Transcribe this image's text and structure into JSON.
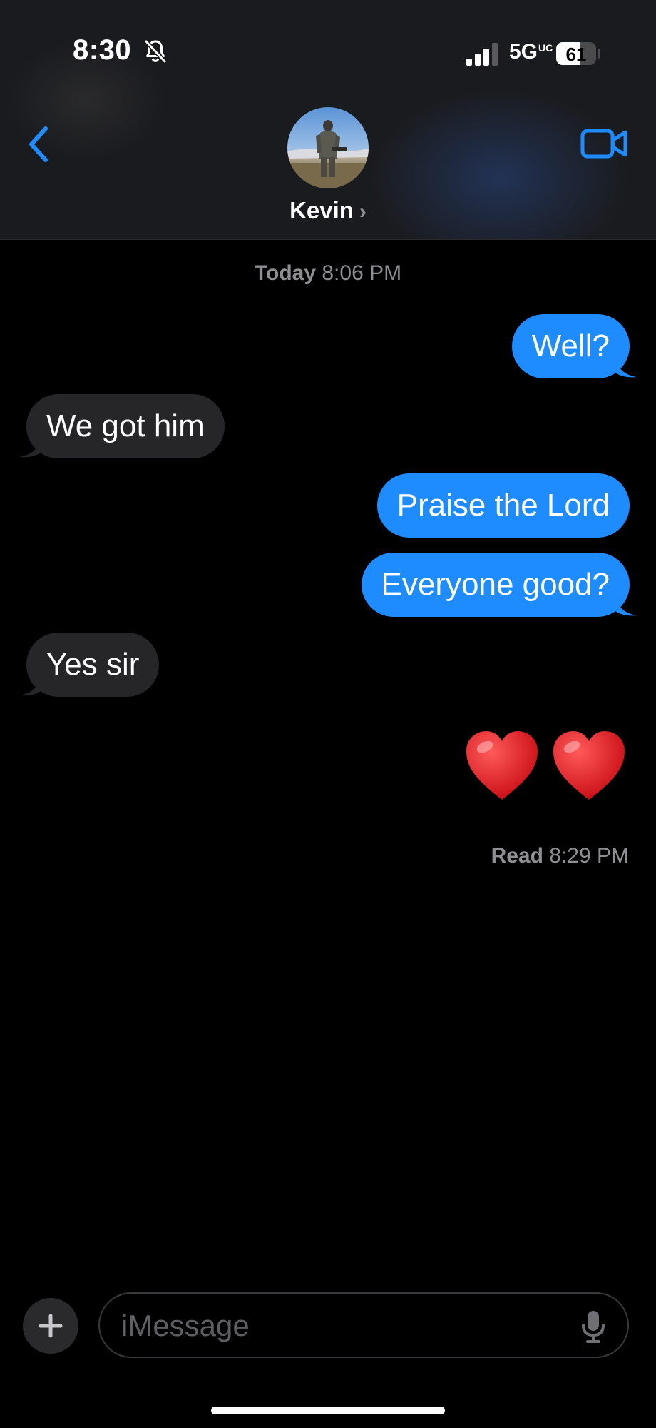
{
  "status_bar": {
    "time": "8:30",
    "network": "5G",
    "network_sub": "UC",
    "battery_percent": 61,
    "battery_label": "61",
    "icons": [
      "bell-slash-icon",
      "signal-bars-icon",
      "battery-icon"
    ]
  },
  "header": {
    "contact_name": "Kevin",
    "chevron": "›",
    "icons": [
      "chevron-left-icon",
      "video-camera-icon"
    ],
    "accent_color": "#1e8bff"
  },
  "conversation": {
    "timestamp_day": "Today",
    "timestamp_time": "8:06 PM",
    "messages": [
      {
        "direction": "sent",
        "text": "Well?"
      },
      {
        "direction": "received",
        "text": "We got him"
      },
      {
        "direction": "sent",
        "text": "Praise the Lord"
      },
      {
        "direction": "sent",
        "text": "Everyone good?"
      },
      {
        "direction": "received",
        "text": "Yes sir"
      },
      {
        "direction": "sent",
        "text": "❤️❤️"
      }
    ],
    "read_label": "Read",
    "read_time": "8:29 PM",
    "colors": {
      "sent": "#1e8bff",
      "received": "#262629"
    }
  },
  "input_bar": {
    "placeholder": "iMessage",
    "icons": [
      "plus-icon",
      "microphone-icon"
    ]
  }
}
